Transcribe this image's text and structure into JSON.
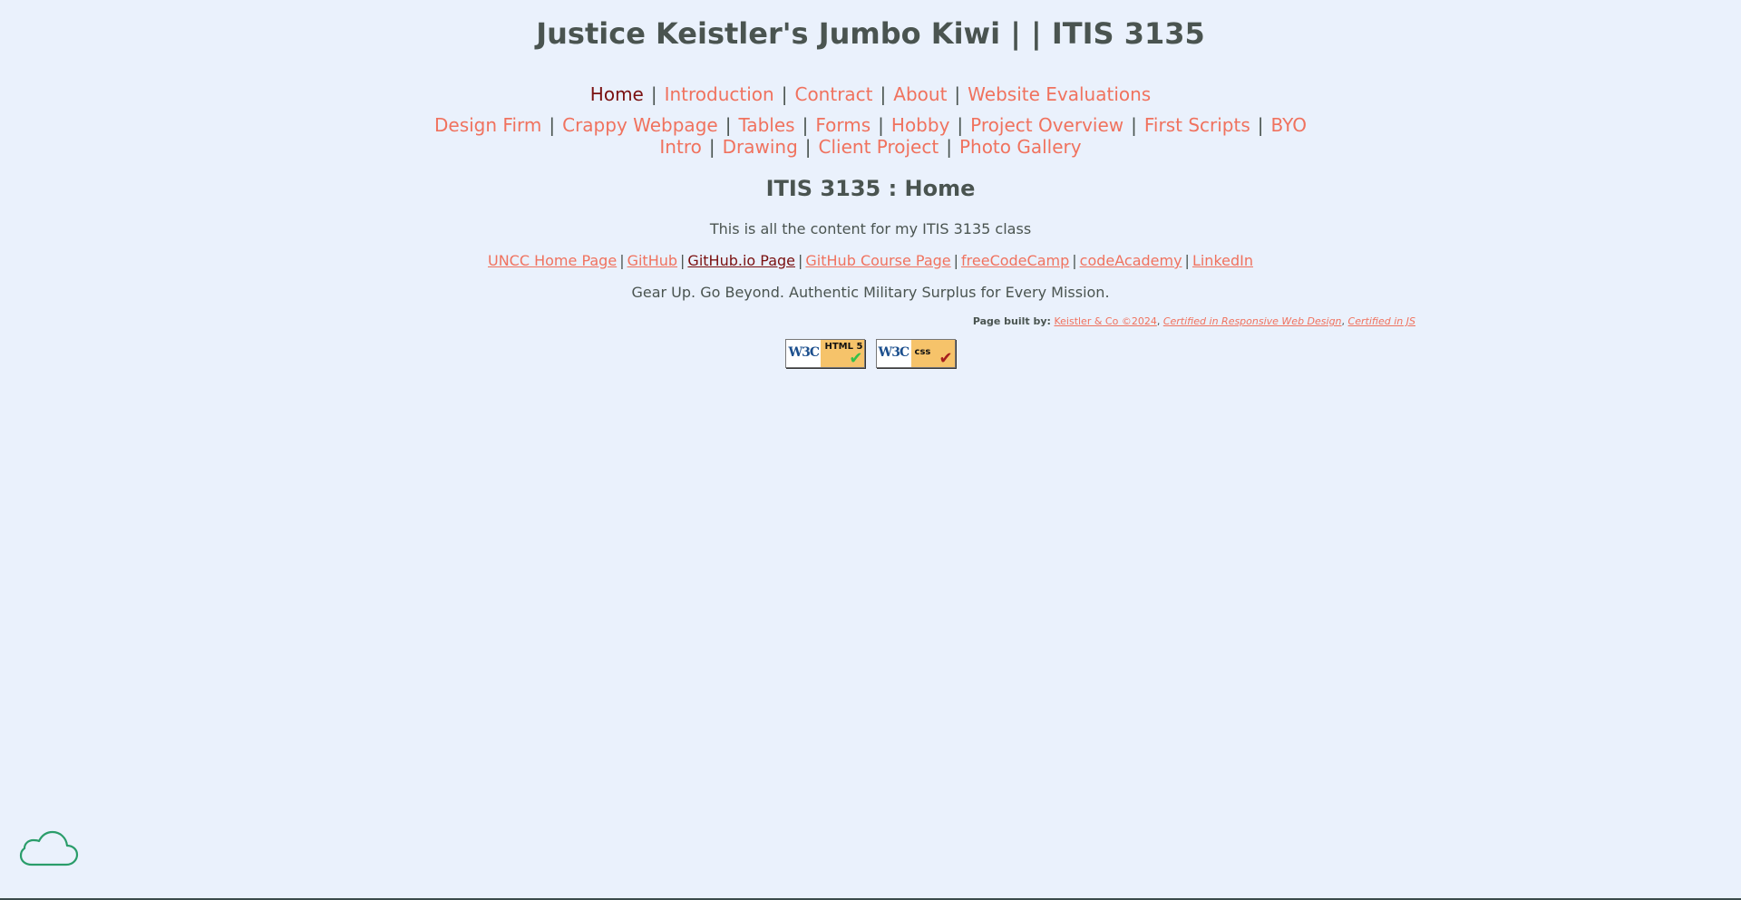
{
  "header": {
    "title": "Justice Keistler's Jumbo Kiwi | | ITIS 3135"
  },
  "nav_primary": [
    {
      "label": "Home"
    },
    {
      "label": "Introduction"
    },
    {
      "label": "Contract"
    },
    {
      "label": "About"
    },
    {
      "label": "Website Evaluations"
    }
  ],
  "nav_secondary": [
    {
      "label": "Design Firm"
    },
    {
      "label": "Crappy Webpage"
    },
    {
      "label": "Tables"
    },
    {
      "label": "Forms"
    },
    {
      "label": "Hobby"
    },
    {
      "label": "Project Overview"
    },
    {
      "label": "First Scripts"
    },
    {
      "label": "BYO Intro"
    },
    {
      "label": "Drawing"
    },
    {
      "label": "Client Project"
    },
    {
      "label": "Photo Gallery"
    }
  ],
  "separator": "|",
  "main": {
    "title": "ITIS 3135 : Home",
    "intro": "This is all the content for my ITIS 3135 class",
    "tagline": "Gear Up. Go Beyond. Authentic Military Surplus for Every Mission."
  },
  "links": [
    {
      "label": "UNCC Home Page"
    },
    {
      "label": "GitHub"
    },
    {
      "label": "GitHub.io Page"
    },
    {
      "label": "GitHub Course Page"
    },
    {
      "label": "freeCodeCamp"
    },
    {
      "label": "codeAcademy"
    },
    {
      "label": "LinkedIn"
    }
  ],
  "footer": {
    "built_by_label": "Page built by:",
    "company": "Keistler & Co ©2024",
    "cert_rwd": "Certified in Responsive Web Design",
    "cert_js": "Certified in JS",
    "comma": ","
  },
  "badges": {
    "w3c": "W3C",
    "html_label": "HTML 5",
    "css_label": "css"
  },
  "colors": {
    "background": "#eaf1fc",
    "link": "#f0725e",
    "active_link": "#7a1010",
    "text": "#4a5450"
  }
}
